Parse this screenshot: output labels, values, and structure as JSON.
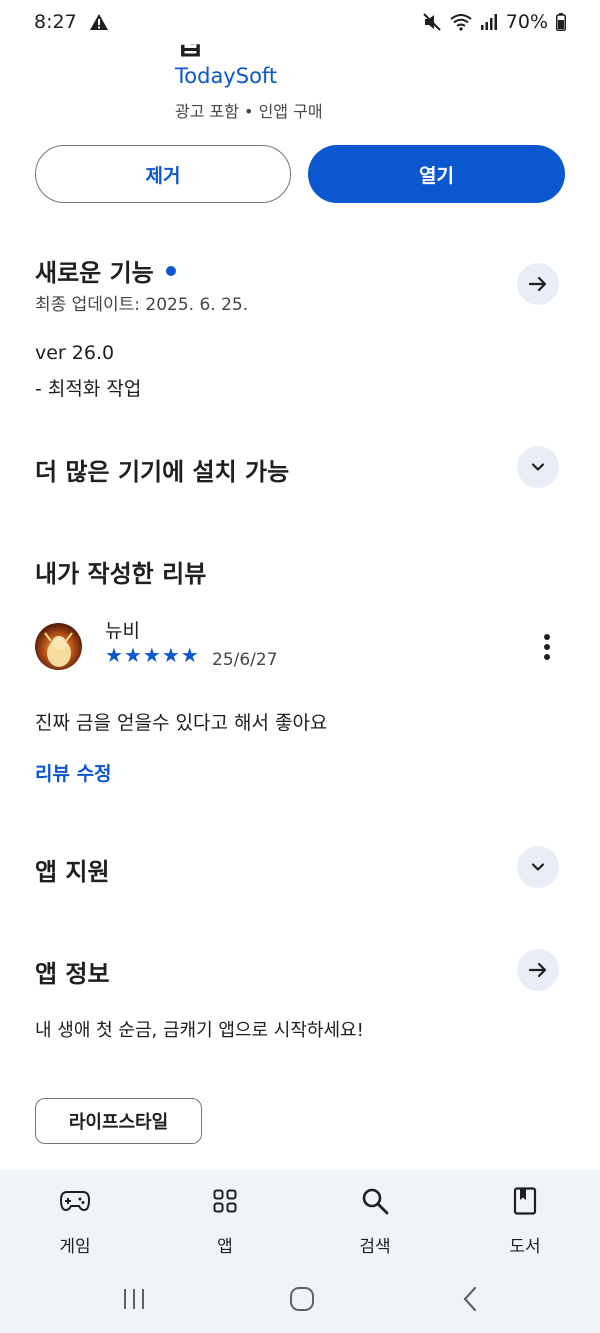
{
  "status_bar": {
    "time": "8:27",
    "battery": "70%"
  },
  "app": {
    "title_partial": "앱",
    "developer": "TodaySoft",
    "meta": "광고 포함 • 인앱 구매"
  },
  "actions": {
    "uninstall_label": "제거",
    "open_label": "열기"
  },
  "whats_new": {
    "title": "새로운 기능",
    "updated": "최종 업데이트: 2025. 6. 25.",
    "version": "ver 26.0",
    "note": "- 최적화 작업"
  },
  "more_devices": {
    "title": "더 많은 기기에 설치 가능"
  },
  "my_review": {
    "title": "내가 작성한 리뷰",
    "reviewer": "뉴비",
    "rating": 5,
    "stars": [
      "★",
      "★",
      "★",
      "★",
      "★"
    ],
    "date": "25/6/27",
    "text": "진짜 금을 얻을수 있다고 해서 좋아요",
    "edit_label": "리뷰 수정"
  },
  "app_support": {
    "title": "앱 지원"
  },
  "app_info": {
    "title": "앱 정보",
    "description": "내 생애 첫 순금, 금캐기 앱으로 시작하세요!",
    "category": "라이프스타일"
  },
  "bottom_nav": {
    "items": [
      {
        "label": "게임",
        "icon": "gamepad-icon"
      },
      {
        "label": "앱",
        "icon": "apps-grid-icon"
      },
      {
        "label": "검색",
        "icon": "search-icon"
      },
      {
        "label": "도서",
        "icon": "book-icon"
      }
    ]
  },
  "colors": {
    "accent": "#0b57d0",
    "chip_bg": "#e9eef6",
    "nav_bg": "#f0f4f9",
    "text": "#1f1f1f",
    "muted": "#444746"
  }
}
